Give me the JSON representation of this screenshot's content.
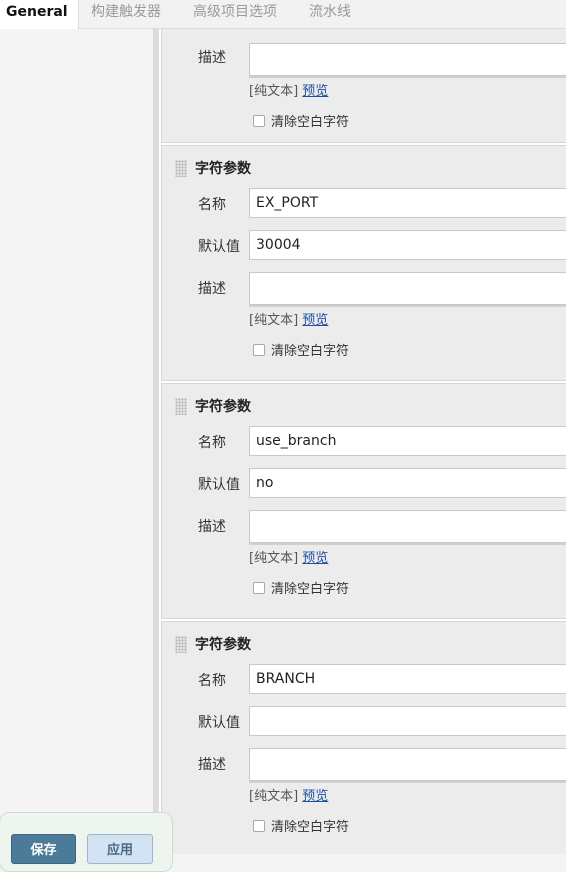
{
  "tabs": [
    {
      "label": "General",
      "active": true
    },
    {
      "label": "构建触发器",
      "active": false
    },
    {
      "label": "高级项目选项",
      "active": false
    },
    {
      "label": "流水线",
      "active": false
    }
  ],
  "field_labels": {
    "name": "名称",
    "default": "默认值",
    "description": "描述"
  },
  "format_prefix": "[纯文本]",
  "preview_link": "预览",
  "trim_label": "清除空白字符",
  "params": [
    {
      "title": "",
      "name": "",
      "default": "",
      "description": "",
      "trim": false
    },
    {
      "title": "字符参数",
      "name": "EX_PORT",
      "default": "30004",
      "description": "",
      "trim": false
    },
    {
      "title": "字符参数",
      "name": "use_branch",
      "default": "no",
      "description": "",
      "trim": false
    },
    {
      "title": "字符参数",
      "name": "BRANCH",
      "default": "",
      "description": "",
      "trim": false
    }
  ],
  "buttons": {
    "save": "保存",
    "apply": "应用"
  }
}
